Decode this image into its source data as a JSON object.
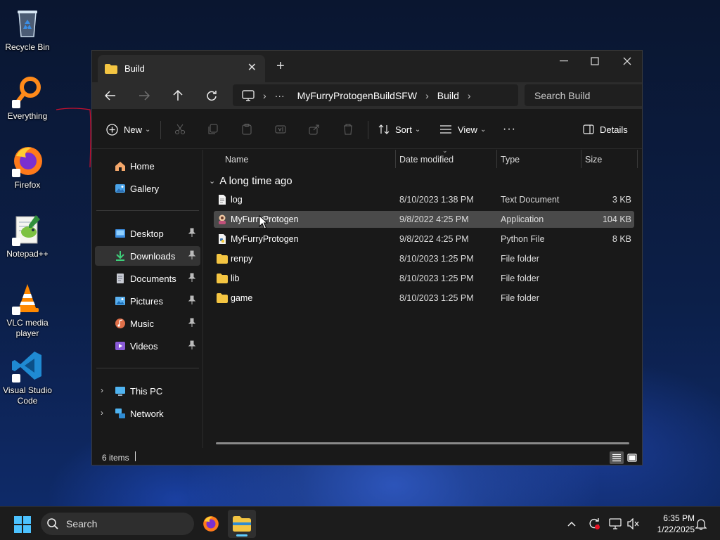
{
  "desktop": {
    "icons": [
      {
        "label": "Recycle Bin",
        "icon": "recycle-bin-icon",
        "shortcut": false
      },
      {
        "label": "Everything",
        "icon": "everything-search-icon",
        "shortcut": true
      },
      {
        "label": "Firefox",
        "icon": "firefox-icon",
        "shortcut": true
      },
      {
        "label": "Notepad++",
        "icon": "notepad-plus-plus-icon",
        "shortcut": true
      },
      {
        "label": "VLC media player",
        "icon": "vlc-cone-icon",
        "shortcut": true
      },
      {
        "label": "Visual Studio Code",
        "icon": "vscode-icon",
        "shortcut": true
      }
    ]
  },
  "window": {
    "tab_title": "Build",
    "new_tab": "+",
    "address": {
      "overflow": "···",
      "segments": [
        "MyFurryProtogenBuildSFW",
        "Build"
      ]
    },
    "search_placeholder": "Search Build"
  },
  "toolbar": {
    "new_label": "New",
    "sort_label": "Sort",
    "view_label": "View",
    "more_label": "···",
    "details_label": "Details",
    "disabled_actions": [
      "cut",
      "copy",
      "paste",
      "rename",
      "share",
      "delete"
    ]
  },
  "nav_pane": {
    "top": [
      {
        "label": "Home",
        "icon": "home-icon"
      },
      {
        "label": "Gallery",
        "icon": "gallery-icon"
      }
    ],
    "pinned": [
      {
        "label": "Desktop",
        "icon": "desktop-folder-icon",
        "selected": false
      },
      {
        "label": "Downloads",
        "icon": "downloads-folder-icon",
        "selected": true
      },
      {
        "label": "Documents",
        "icon": "documents-folder-icon",
        "selected": false
      },
      {
        "label": "Pictures",
        "icon": "pictures-folder-icon",
        "selected": false
      },
      {
        "label": "Music",
        "icon": "music-folder-icon",
        "selected": false
      },
      {
        "label": "Videos",
        "icon": "videos-folder-icon",
        "selected": false
      }
    ],
    "bottom": [
      {
        "label": "This PC",
        "icon": "this-pc-icon"
      },
      {
        "label": "Network",
        "icon": "network-icon"
      }
    ]
  },
  "file_list": {
    "columns": [
      "Name",
      "Date modified",
      "Type",
      "Size"
    ],
    "group": "A long time ago",
    "rows": [
      {
        "name": "log",
        "date": "8/10/2023 1:38 PM",
        "type": "Text Document",
        "size": "3 KB",
        "kind": "text"
      },
      {
        "name": "MyFurryProtogen",
        "date": "9/8/2022 4:25 PM",
        "type": "Application",
        "size": "104 KB",
        "kind": "app",
        "hovered": true
      },
      {
        "name": "MyFurryProtogen",
        "date": "9/8/2022 4:25 PM",
        "type": "Python File",
        "size": "8 KB",
        "kind": "python"
      },
      {
        "name": "renpy",
        "date": "8/10/2023 1:25 PM",
        "type": "File folder",
        "size": "",
        "kind": "folder"
      },
      {
        "name": "lib",
        "date": "8/10/2023 1:25 PM",
        "type": "File folder",
        "size": "",
        "kind": "folder"
      },
      {
        "name": "game",
        "date": "8/10/2023 1:25 PM",
        "type": "File folder",
        "size": "",
        "kind": "folder"
      }
    ]
  },
  "status": {
    "item_count": "6 items",
    "active_view": "details"
  },
  "taskbar": {
    "search_label": "Search",
    "time": "6:35 PM",
    "date": "1/22/2025",
    "active_app": "file-explorer"
  },
  "colors": {
    "accent": "#60cdff",
    "folder": "#f4c542",
    "window_bg": "#191919",
    "hover_row": "#4a4a4a"
  }
}
